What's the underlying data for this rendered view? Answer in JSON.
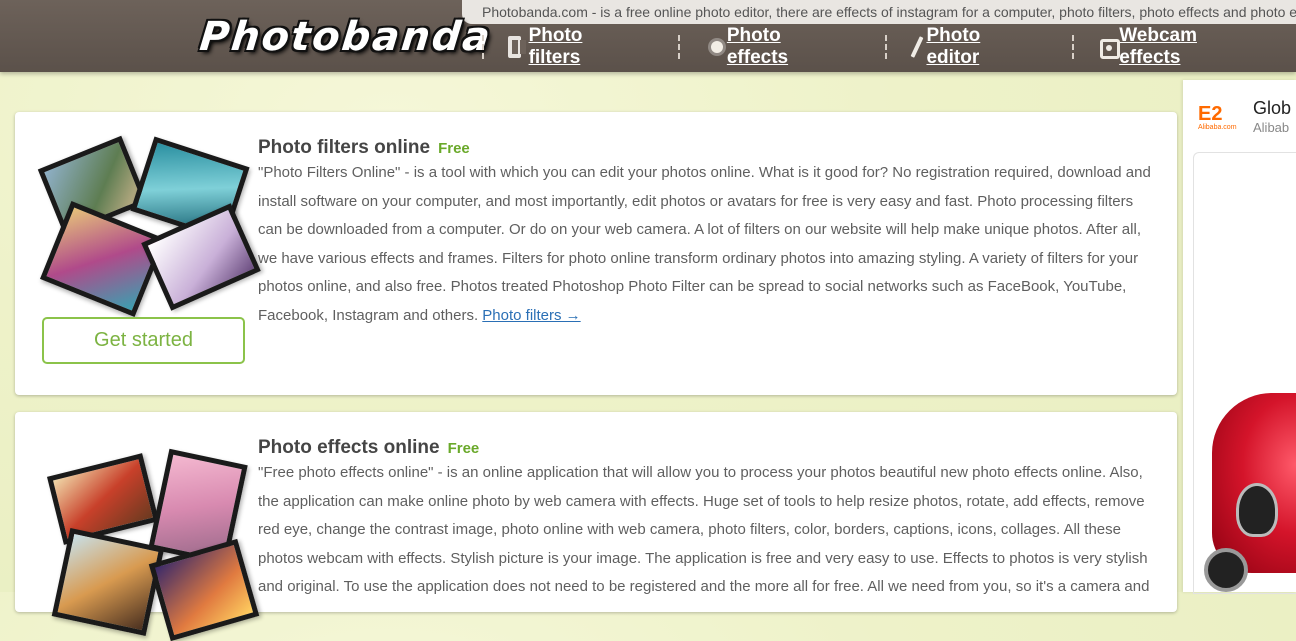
{
  "header": {
    "tagline": "Photobanda.com - is a free online photo editor, there are effects of instagram for a computer, photo filters, photo effects and photo editor",
    "logo": "Photobanda",
    "nav": [
      {
        "label": "Photo filters",
        "icon": "film-icon"
      },
      {
        "label": "Photo effects",
        "icon": "bulb-icon"
      },
      {
        "label": "Photo editor",
        "icon": "pencil-icon"
      },
      {
        "label": "Webcam effects",
        "icon": "webcam-icon"
      }
    ]
  },
  "cards": [
    {
      "title": "Photo filters online",
      "badge": "Free",
      "text": "\"Photo Filters Online\" - is a tool with which you can edit your photos online. What is it good for? No registration required, download and install software on your computer, and most importantly, edit photos or avatars for free is very easy and fast. Photo processing filters can be downloaded from a computer. Or do on your web camera. A lot of filters on our website will help make unique photos. After all, we have various effects and frames. Filters for photo online transform ordinary photos into amazing styling. A variety of filters for your photos online, and also free. Photos treated Photoshop Photo Filter can be spread to social networks such as FaceBook, YouTube, Facebook, Instagram and others.",
      "link": "Photo filters →",
      "button": "Get started"
    },
    {
      "title": "Photo effects online",
      "badge": "Free",
      "text": "\"Free photo effects online\" - is an online application that will allow you to process your photos beautiful new photo effects online. Also, the application can make online photo by web camera with effects. Huge set of tools to help resize photos, rotate, add effects, remove red eye, change the contrast image, photo online with web camera, photo filters, color, borders, captions, icons, collages. All these photos webcam with effects. Stylish picture is your image. The application is free and very easy to use. Effects to photos is very stylish and original. To use the application does not need to be registered and the more all for free. All we need from you, so it's a camera and"
    }
  ],
  "ad": {
    "title": "Glob",
    "subtitle": "Alibab",
    "brand_mark": "E2",
    "brand_name": "Alibaba.com"
  }
}
